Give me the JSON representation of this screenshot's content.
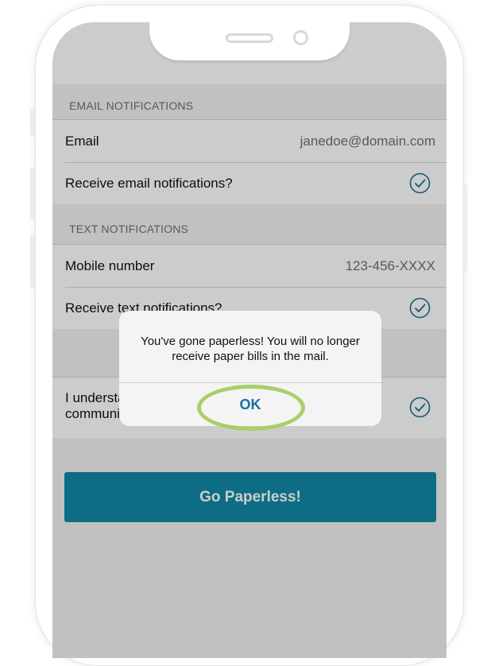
{
  "email_section": {
    "header": "EMAIL NOTIFICATIONS",
    "email_label": "Email",
    "email_value": "janedoe@domain.com",
    "receive_label": "Receive email notifications?",
    "receive_checked": true
  },
  "text_section": {
    "header": "TEXT NOTIFICATIONS",
    "mobile_label": "Mobile number",
    "mobile_value": "123-456-XXXX",
    "receive_label": "Receive text notifications?",
    "receive_checked": true
  },
  "paperless_section": {
    "consent_label": "I understand I will no longer receive paper communication in the mail.",
    "consent_checked": true
  },
  "cta_label": "Go Paperless!",
  "alert": {
    "message": "You've gone paperless! You will no longer receive paper bills in the mail.",
    "ok_label": "OK"
  },
  "colors": {
    "accent": "#1189a7",
    "highlight_ring": "#a8cf6a",
    "check": "#1a6fa0"
  },
  "icons": {
    "check": "check-circle-icon"
  }
}
